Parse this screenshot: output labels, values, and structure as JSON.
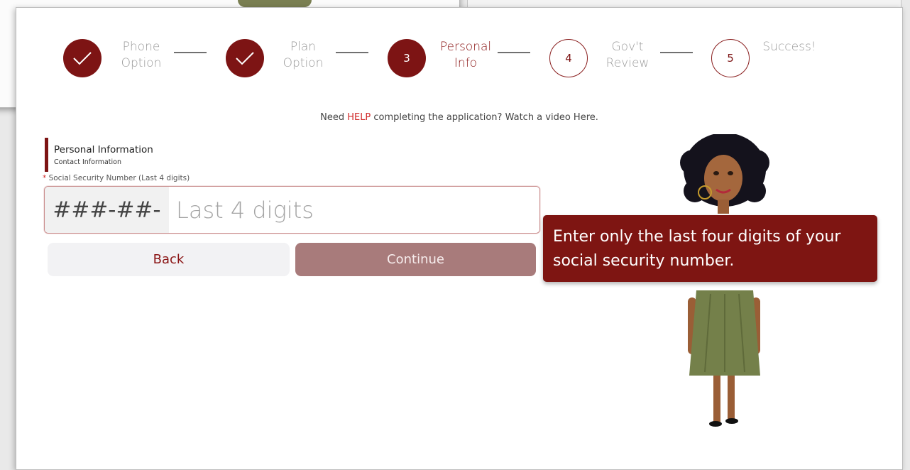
{
  "stepper": {
    "steps": [
      {
        "number": "",
        "label_line1": "Phone",
        "label_line2": "Option",
        "state": "done"
      },
      {
        "number": "",
        "label_line1": "Plan",
        "label_line2": "Option",
        "state": "done"
      },
      {
        "number": "3",
        "label_line1": "Personal",
        "label_line2": "Info",
        "state": "active"
      },
      {
        "number": "4",
        "label_line1": "Gov't",
        "label_line2": "Review",
        "state": "todo"
      },
      {
        "number": "5",
        "label_line1": "Success!",
        "label_line2": "",
        "state": "todo"
      }
    ]
  },
  "help": {
    "prefix": "Need ",
    "link": "HELP",
    "suffix": " completing the application? Watch a video Here."
  },
  "section": {
    "title": "Personal Information",
    "subtitle": "Contact Information"
  },
  "ssn": {
    "required_mark": "*",
    "label": " Social Security Number (Last 4 digits)",
    "prefix": "###-##-",
    "placeholder": "Last 4 digits",
    "value": ""
  },
  "buttons": {
    "back": "Back",
    "continue": "Continue"
  },
  "tooltip": {
    "text": "Enter only the last four digits of your social security number."
  },
  "colors": {
    "brand": "#7d1414",
    "accent_link": "#d02a2a",
    "continue_disabled": "#a87b7b"
  }
}
